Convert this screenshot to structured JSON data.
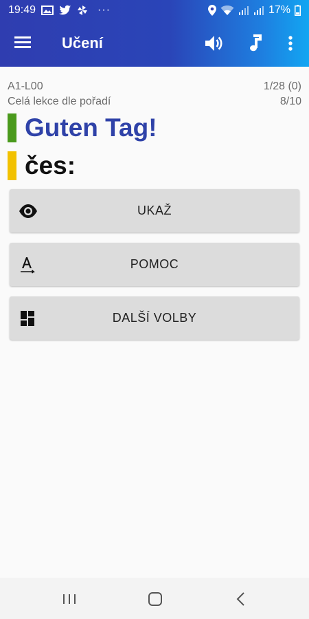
{
  "status_bar": {
    "time": "19:49",
    "more_indicator": "···",
    "battery_percent": "17%"
  },
  "toolbar": {
    "title": "Učení"
  },
  "lesson": {
    "code": "A1-L00",
    "mode": "Celá lekce dle pořadí",
    "progress": "1/28 (0)",
    "score": "8/10"
  },
  "card": {
    "german_word": "Guten Tag!",
    "czech_label": "čes:",
    "colors": {
      "german_bar": "#4a9a1c",
      "czech_bar": "#f2c100"
    }
  },
  "actions": {
    "show_label": "UKAŽ",
    "help_label": "POMOC",
    "more_label": "DALŠÍ VOLBY"
  },
  "icons": {
    "menu": "hamburger-icon",
    "speaker": "volume-icon",
    "music": "music-note-icon",
    "overflow": "more-vert-icon",
    "show": "eye-icon",
    "help": "font-hint-icon",
    "more": "dashboard-icon"
  },
  "colors": {
    "header_start": "#2f3db0",
    "header_end": "#12a6f2",
    "button_bg": "#dcdcdc"
  }
}
